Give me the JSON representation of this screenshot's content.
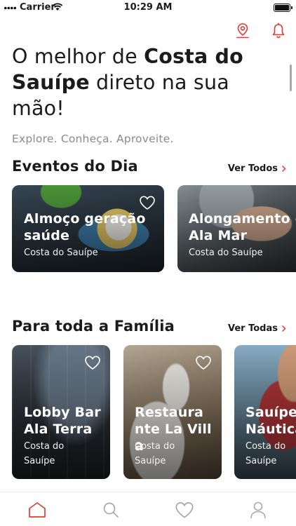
{
  "status_bar": {
    "carrier": "Carrier",
    "time": "10:29 AM"
  },
  "header": {
    "icons": [
      "map-pin-icon",
      "bell-icon"
    ],
    "accent_color": "#e53935"
  },
  "hero": {
    "text_before": "O melhor de ",
    "bold": "Costa do Sauípe",
    "text_after": " direto na sua mão!",
    "subtitle": "Explore. Conheça. Aproveite."
  },
  "events_section": {
    "title": "Eventos do Dia",
    "see_all": "Ver Todos",
    "cards": [
      {
        "title": "Almoço geração saúde",
        "location": "Costa do Sauípe"
      },
      {
        "title": "Alongamento - Ala Mar",
        "location": "Costa do Sauípe"
      }
    ]
  },
  "family_section": {
    "title": "Para toda a Família",
    "see_all": "Ver Todas",
    "cards": [
      {
        "title": "Lobby Bar Ala Terra",
        "location": "Costa do Sauípe"
      },
      {
        "title": "Restaurante La Villa",
        "location": "Costa do Sauípe"
      },
      {
        "title": "Sauípe Náutica",
        "location": "Costa do Sauípe"
      }
    ]
  },
  "tab_bar": {
    "tabs": [
      "home-icon",
      "search-icon",
      "heart-icon",
      "profile-icon"
    ],
    "active": "home-icon"
  }
}
